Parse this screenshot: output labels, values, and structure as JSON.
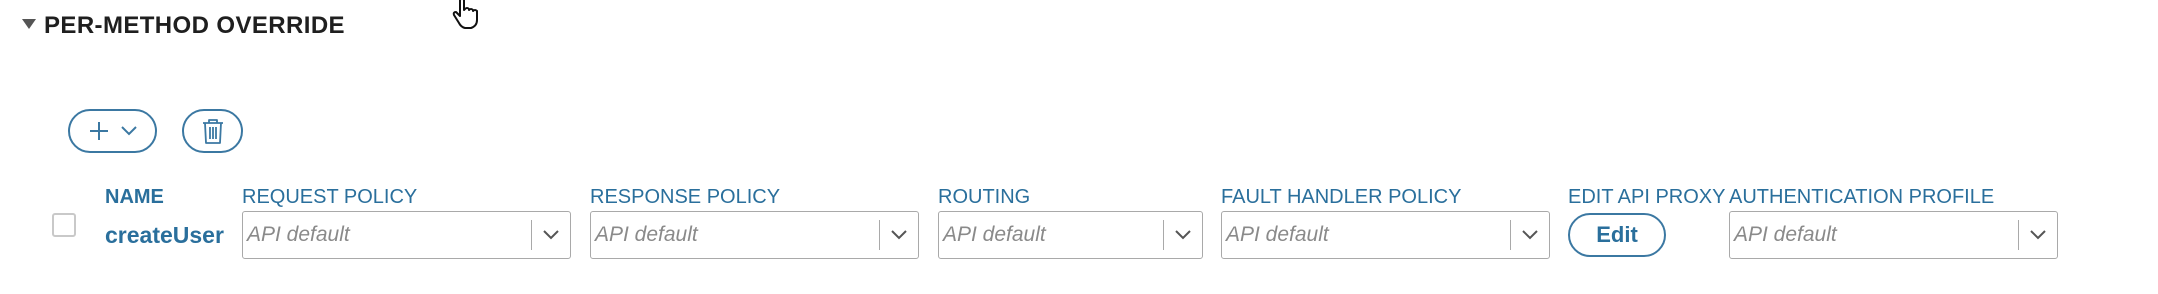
{
  "section": {
    "title": "PER-METHOD OVERRIDE"
  },
  "toolbar": {
    "add_icon": "plus-icon",
    "dropdown_icon": "chevron-down-icon",
    "delete_icon": "trash-icon"
  },
  "columns": {
    "name": "NAME",
    "request_policy": "REQUEST POLICY",
    "response_policy": "RESPONSE POLICY",
    "routing": "ROUTING",
    "fault_handler_policy": "FAULT HANDLER POLICY",
    "edit_api_proxy": "EDIT API PROXY",
    "authentication_profile": "AUTHENTICATION PROFILE"
  },
  "rows": [
    {
      "name": "createUser",
      "checked": false,
      "request_policy": "API default",
      "response_policy": "API default",
      "routing": "API default",
      "fault_handler_policy": "API default",
      "edit_label": "Edit",
      "authentication_profile": "API default"
    }
  ],
  "colors": {
    "accent": "#2a6f9c",
    "border": "#a9a9a9",
    "placeholder": "#8a8a8a"
  }
}
